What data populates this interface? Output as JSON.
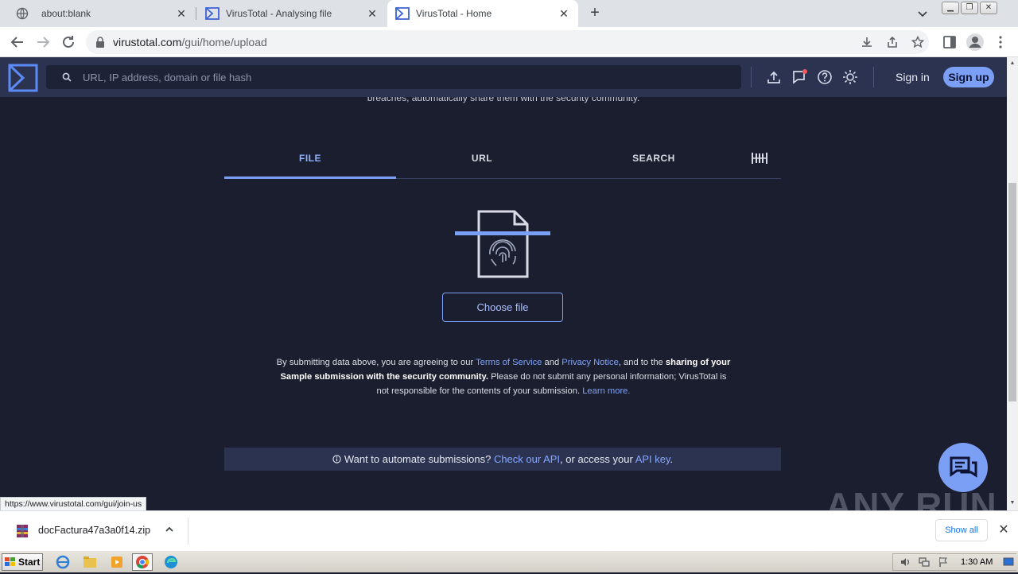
{
  "browser": {
    "tabs": [
      {
        "title": "about:blank",
        "active": false
      },
      {
        "title": "VirusTotal - Analysing file",
        "active": false
      },
      {
        "title": "VirusTotal - Home",
        "active": true
      }
    ],
    "url_host": "virustotal.com",
    "url_path": "/gui/home/upload"
  },
  "vt": {
    "search_placeholder": "URL, IP address, domain or file hash",
    "sign_in": "Sign in",
    "sign_up": "Sign up",
    "partial_intro": "breaches, automatically share them with the security community.",
    "tabs": [
      {
        "label": "FILE",
        "active": true
      },
      {
        "label": "URL",
        "active": false
      },
      {
        "label": "SEARCH",
        "active": false
      }
    ],
    "choose_file": "Choose file",
    "legal": {
      "p1": "By submitting data above, you are agreeing to our ",
      "terms": "Terms of Service",
      "and": " and ",
      "privacy": "Privacy Notice",
      "p2": ", and to the ",
      "bold": "sharing of your Sample submission with the security community.",
      "p3": " Please do not submit any personal information; VirusTotal is not responsible for the contents of your submission. ",
      "learn": "Learn more."
    },
    "api": {
      "text1": "Want to automate submissions? ",
      "link1": "Check our API",
      "text2": ", or access your ",
      "link2": "API key",
      "text3": "."
    },
    "accent_color": "#7b9ff5"
  },
  "status_bar_url": "https://www.virustotal.com/gui/join-us",
  "watermark": "ANY RUN",
  "download": {
    "filename": "docFactura47a3a0f14.zip",
    "show_all": "Show all"
  },
  "taskbar": {
    "start": "Start",
    "clock": "1:30 AM"
  }
}
